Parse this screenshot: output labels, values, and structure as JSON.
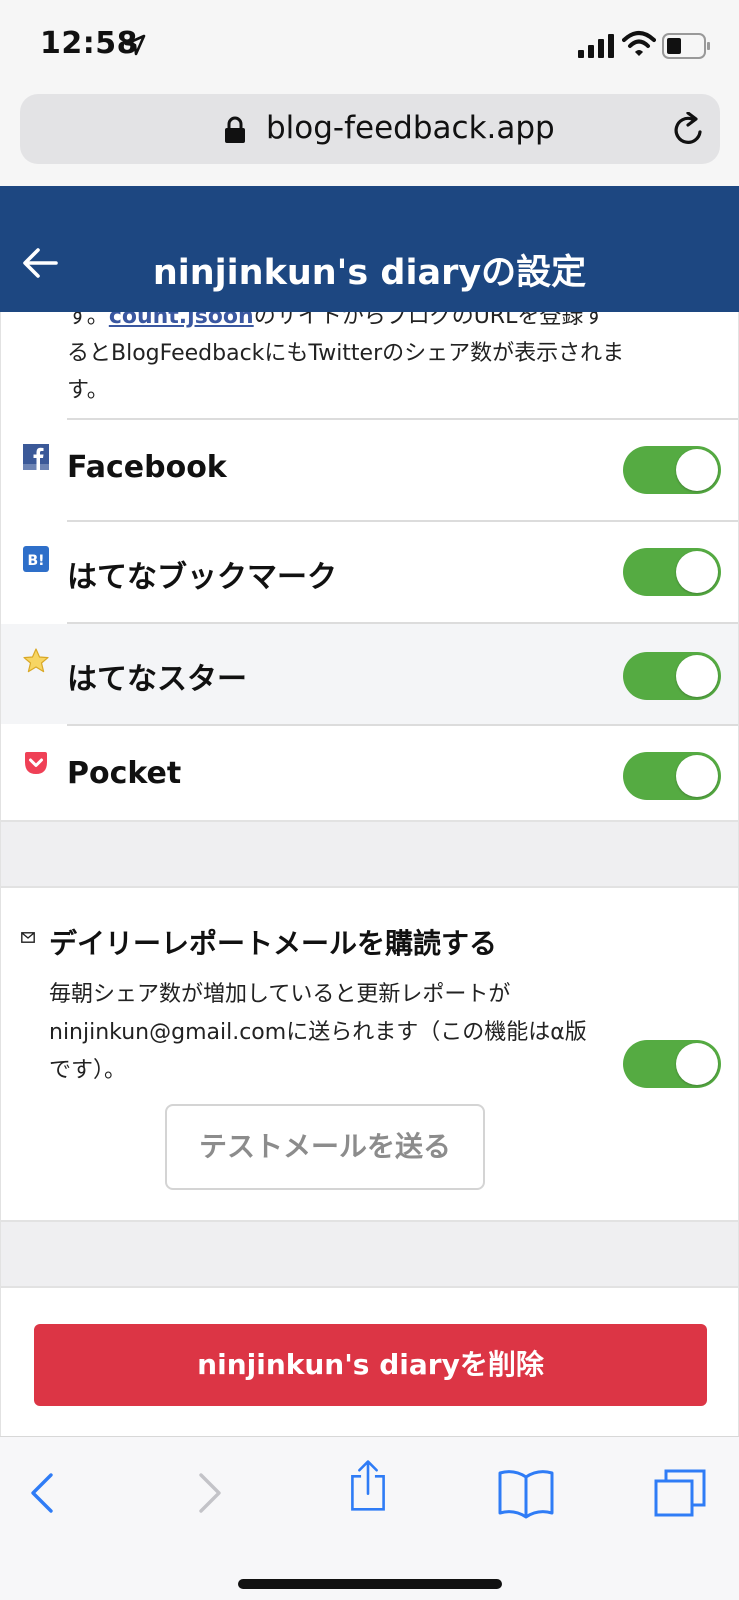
{
  "status_bar": {
    "time": "12:58",
    "icons": [
      "location-arrow-icon",
      "signal-icon",
      "wifi-icon",
      "battery-icon"
    ]
  },
  "browser": {
    "url": "blog-feedback.app",
    "icons": [
      "lock-icon",
      "reload-icon"
    ]
  },
  "header": {
    "title": "ninjinkun's diaryの設定",
    "back_icon": "back-arrow-icon",
    "background_color": "#1d4781"
  },
  "twitter_note": {
    "prefix": "す。",
    "link_text": "count.jsoon",
    "suffix": "のサイトからブログのURLを登録するとBlogFeedbackにもTwitterのシェア数が表示されます。"
  },
  "services": [
    {
      "label": "Facebook",
      "icon": "facebook-icon",
      "enabled": true
    },
    {
      "label": "はてなブックマーク",
      "icon": "hatena-bookmark-icon",
      "enabled": true
    },
    {
      "label": "はてなスター",
      "icon": "star-icon",
      "enabled": true
    },
    {
      "label": "Pocket",
      "icon": "pocket-icon",
      "enabled": true
    }
  ],
  "daily_report": {
    "icon": "mail-icon",
    "title": "デイリーレポートメールを購読する",
    "description": "毎朝シェア数が増加していると更新レポートがninjinkun@gmail.comに送られます（この機能はα版です）。",
    "enabled": true,
    "test_button": "テストメールを送る"
  },
  "delete_button": "ninjinkun's diaryを削除",
  "toolbar": {
    "icons": [
      "browser-back-icon",
      "browser-forward-icon",
      "share-icon",
      "bookmarks-icon",
      "tabs-icon"
    ]
  },
  "colors": {
    "toggle_on": "#55ab42",
    "danger": "#dc3545",
    "link": "#3a57a0",
    "ios_blue": "#2f7cf6"
  }
}
